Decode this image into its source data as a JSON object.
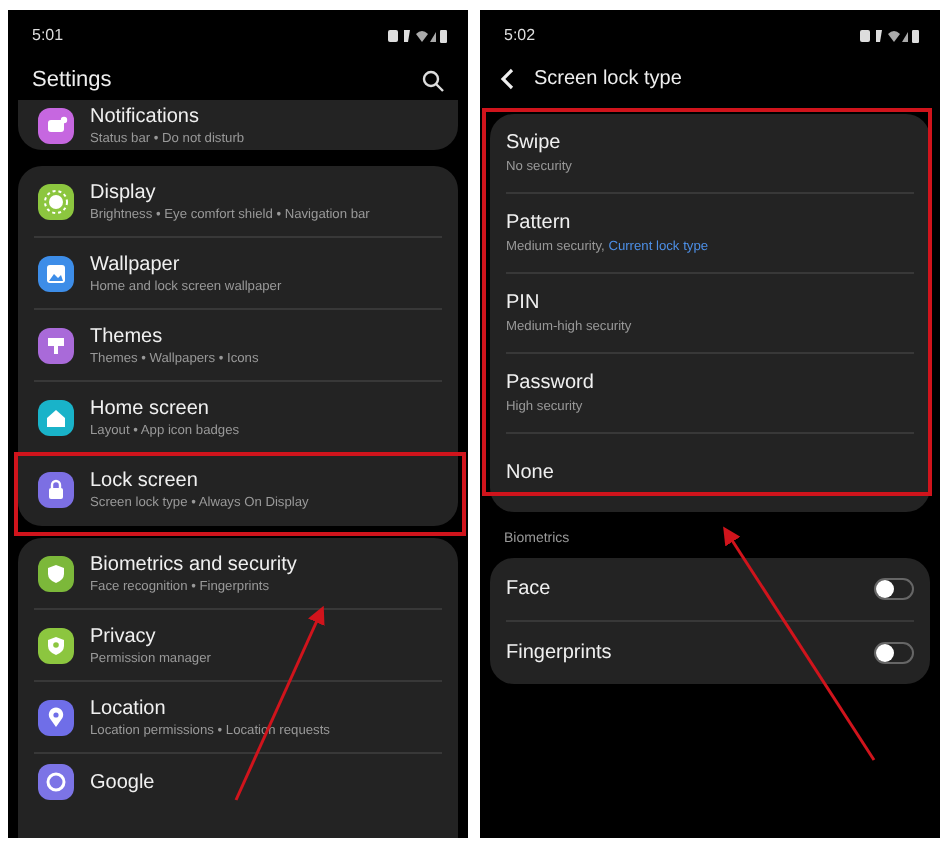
{
  "settings_screen": {
    "status_bar": {
      "time": "5:01"
    },
    "title": "Settings",
    "top_card": [
      {
        "kind": "notification",
        "color": "#c667e0",
        "title": "Notifications",
        "subtitle": "Status bar • Do not disturb"
      }
    ],
    "items": [
      {
        "kind": "display",
        "color": "#8cc63f",
        "title": "Display",
        "subtitle": "Brightness • Eye comfort shield • Navigation bar"
      },
      {
        "kind": "wallpaper",
        "color": "#3d8de8",
        "title": "Wallpaper",
        "subtitle": "Home and lock screen wallpaper"
      },
      {
        "kind": "theme",
        "color": "#a96ad9",
        "title": "Themes",
        "subtitle": "Themes • Wallpapers • Icons"
      },
      {
        "kind": "home",
        "color": "#19b3c9",
        "title": "Home screen",
        "subtitle": "Layout • App icon badges"
      },
      {
        "kind": "lock",
        "color": "#7c6fe3",
        "title": "Lock screen",
        "subtitle": "Screen lock type • Always On Display"
      }
    ],
    "lower_items": [
      {
        "kind": "shield",
        "color": "#7cb83a",
        "title": "Biometrics and security",
        "subtitle": "Face recognition • Fingerprints"
      },
      {
        "kind": "privacy",
        "color": "#8cc63f",
        "title": "Privacy",
        "subtitle": "Permission manager"
      },
      {
        "kind": "location",
        "color": "#6f6ee8",
        "title": "Location",
        "subtitle": "Location permissions • Location requests"
      },
      {
        "kind": "google",
        "color": "#7c74e6",
        "title": "Google"
      }
    ]
  },
  "lock_type_screen": {
    "status_bar": {
      "time": "5:02"
    },
    "title": "Screen lock type",
    "options": [
      {
        "title": "Swipe",
        "subtitle": "No security"
      },
      {
        "title": "Pattern",
        "subtitle": "Medium security, ",
        "note": "Current lock type"
      },
      {
        "title": "PIN",
        "subtitle": "Medium-high security"
      },
      {
        "title": "Password",
        "subtitle": "High security"
      },
      {
        "title": "None"
      }
    ],
    "section_label": "Biometrics",
    "toggles": [
      {
        "title": "Face",
        "on": false
      },
      {
        "title": "Fingerprints",
        "on": false
      }
    ]
  }
}
